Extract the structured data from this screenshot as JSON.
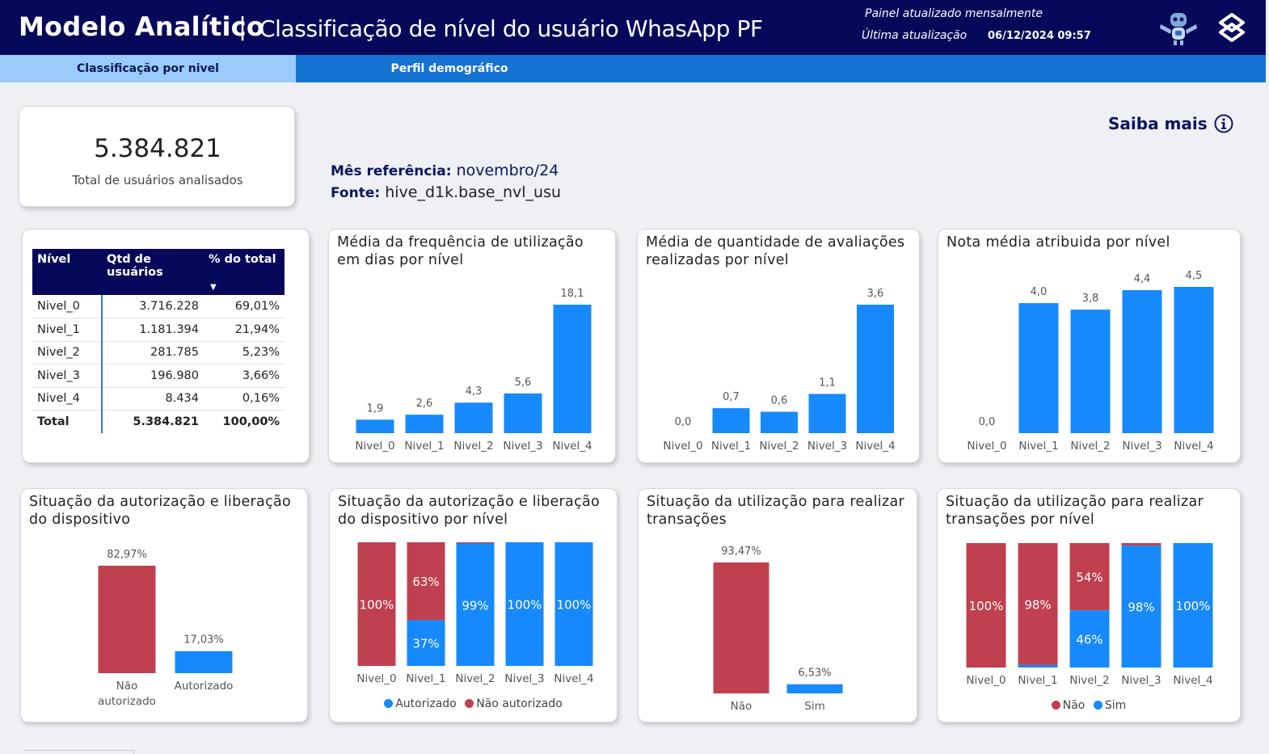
{
  "header": {
    "title": "Modelo Analítico",
    "separator": "|",
    "subtitle": "Classificação de nível do usuário WhasApp PF",
    "update_note": "Painel atualizado mensalmente",
    "last_update_label": "Última atualização",
    "last_update_value": "06/12/2024 09:57",
    "icons": [
      "robot-icon",
      "banco-do-brasil-logo"
    ]
  },
  "tabs": [
    {
      "label": "Classificação por nivel",
      "active": true
    },
    {
      "label": "Perfil demográfico",
      "active": false
    }
  ],
  "kpi": {
    "value": "5.384.821",
    "label": "Total de usuários analisados"
  },
  "reference": {
    "month_label": "Mês referência:",
    "month_value": "novembro/24",
    "source_label": "Fonte:",
    "source_value": "hive_d1k.base_nvl_usu"
  },
  "saiba_mais": {
    "label": "Saiba mais",
    "icon": "info-icon"
  },
  "table": {
    "headers": [
      "Nível",
      "Qtd de usuários",
      "% do total"
    ],
    "rows": [
      [
        "Nivel_0",
        "3.716.228",
        "69,01%"
      ],
      [
        "Nivel_1",
        "1.181.394",
        "21,94%"
      ],
      [
        "Nivel_2",
        "281.785",
        "5,23%"
      ],
      [
        "Nivel_3",
        "196.980",
        "3,66%"
      ],
      [
        "Nivel_4",
        "8.434",
        "0,16%"
      ]
    ],
    "total": [
      "Total",
      "5.384.821",
      "100,00%"
    ]
  },
  "colors": {
    "blue": "#1689fc",
    "red": "#c0404f",
    "navy": "#06085a"
  },
  "chart_data": [
    {
      "id": "freq",
      "type": "bar",
      "title": "Média da frequência de utilização em dias por nível",
      "categories": [
        "Nivel_0",
        "Nivel_1",
        "Nivel_2",
        "Nivel_3",
        "Nivel_4"
      ],
      "values": [
        1.9,
        2.6,
        4.3,
        5.6,
        18.1
      ],
      "labels": [
        "1,9",
        "2,6",
        "4,3",
        "5,6",
        "18,1"
      ],
      "ylim": [
        0,
        18.1
      ]
    },
    {
      "id": "aval",
      "type": "bar",
      "title": "Média de quantidade de avaliações realizadas por nível",
      "categories": [
        "Nivel_0",
        "Nivel_1",
        "Nivel_2",
        "Nivel_3",
        "Nivel_4"
      ],
      "values": [
        0.0,
        0.7,
        0.6,
        1.1,
        3.6
      ],
      "labels": [
        "0,0",
        "0,7",
        "0,6",
        "1,1",
        "3,6"
      ],
      "ylim": [
        0,
        3.6
      ]
    },
    {
      "id": "nota",
      "type": "bar",
      "title": "Nota média atribuida por nível",
      "categories": [
        "Nivel_0",
        "Nivel_1",
        "Nivel_2",
        "Nivel_3",
        "Nivel_4"
      ],
      "values": [
        0.0,
        4.0,
        3.8,
        4.4,
        4.5
      ],
      "labels": [
        "0,0",
        "4,0",
        "3,8",
        "4,4",
        "4,5"
      ],
      "ylim": [
        0,
        4.5
      ]
    },
    {
      "id": "auth",
      "type": "bar",
      "title": "Situação da autorização e liberação do dispositivo",
      "categories": [
        "Não autorizado",
        "Autorizado"
      ],
      "values": [
        82.97,
        17.03
      ],
      "labels": [
        "82,97%",
        "17,03%"
      ],
      "bar_colors": [
        "#c0404f",
        "#1689fc"
      ],
      "ylim": [
        0,
        82.97
      ]
    },
    {
      "id": "auth_lvl",
      "type": "stacked_bar",
      "title": "Situação da autorização e liberação do dispositivo por nível",
      "categories": [
        "Nivel_0",
        "Nivel_1",
        "Nivel_2",
        "Nivel_3",
        "Nivel_4"
      ],
      "series": [
        {
          "name": "Autorizado",
          "color": "#1689fc",
          "values": [
            0,
            37,
            99,
            100,
            100
          ],
          "labels": [
            "",
            "37%",
            "99%",
            "100%",
            "100%"
          ]
        },
        {
          "name": "Não autorizado",
          "color": "#c0404f",
          "values": [
            100,
            63,
            1,
            0,
            0
          ],
          "labels": [
            "100%",
            "63%",
            "",
            "",
            ""
          ]
        }
      ]
    },
    {
      "id": "trans",
      "type": "bar",
      "title": "Situação da utilização para realizar transações",
      "categories": [
        "Não",
        "Sim"
      ],
      "values": [
        93.47,
        6.53
      ],
      "labels": [
        "93,47%",
        "6,53%"
      ],
      "bar_colors": [
        "#c0404f",
        "#1689fc"
      ],
      "ylim": [
        0,
        93.47
      ]
    },
    {
      "id": "trans_lvl",
      "type": "stacked_bar",
      "title": "Situação da utilização para realizar transações por nível",
      "categories": [
        "Nivel_0",
        "Nivel_1",
        "Nivel_2",
        "Nivel_3",
        "Nivel_4"
      ],
      "series": [
        {
          "name": "Sim",
          "color": "#1689fc",
          "values": [
            0,
            2,
            46,
            98,
            100
          ],
          "labels": [
            "",
            "",
            "46%",
            "98%",
            "100%"
          ]
        },
        {
          "name": "Não",
          "color": "#c0404f",
          "values": [
            100,
            98,
            54,
            2,
            0
          ],
          "labels": [
            "100%",
            "98%",
            "54%",
            "",
            ""
          ]
        }
      ]
    }
  ]
}
